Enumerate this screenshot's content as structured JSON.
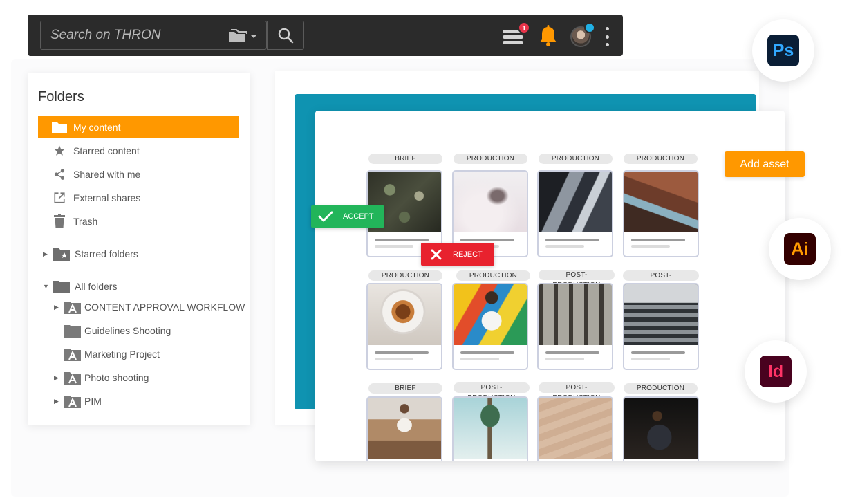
{
  "topbar": {
    "search_placeholder": "Search on THRON",
    "notifications_count": "1"
  },
  "folders": {
    "title": "Folders",
    "nav": [
      {
        "label": "My content",
        "icon": "folder-icon",
        "active": true
      },
      {
        "label": "Starred content",
        "icon": "star-icon"
      },
      {
        "label": "Shared with me",
        "icon": "share-icon"
      },
      {
        "label": "External shares",
        "icon": "external-link-icon"
      },
      {
        "label": "Trash",
        "icon": "trash-icon"
      }
    ],
    "starred_folders": "Starred folders",
    "all_folders": "All folders",
    "tree": [
      {
        "label": "CONTENT APPROVAL WORKFLOW",
        "icon": "shared-folder-icon",
        "expandable": true
      },
      {
        "label": "Guidelines Shooting",
        "icon": "folder-icon",
        "expandable": false
      },
      {
        "label": "Marketing Project",
        "icon": "shared-folder-icon",
        "expandable": false
      },
      {
        "label": "Photo shooting",
        "icon": "shared-folder-icon",
        "expandable": true
      },
      {
        "label": "PIM",
        "icon": "shared-folder-icon",
        "expandable": true
      }
    ]
  },
  "workflow": {
    "accept_label": "ACCEPT",
    "reject_label": "REJECT",
    "add_asset_label": "Add asset",
    "rows": [
      [
        "BRIEF",
        "PRODUCTION",
        "PRODUCTION",
        "PRODUCTION"
      ],
      [
        "PRODUCTION",
        "PRODUCTION",
        "POST-PRODUCTION",
        "POST-PRODUCTION"
      ],
      [
        "BRIEF",
        "POST-PRODUCTION",
        "POST-PRODUCTION",
        "PRODUCTION"
      ]
    ]
  },
  "apps": {
    "photoshop": "Ps",
    "illustrator": "Ai",
    "indesign": "Id"
  },
  "colors": {
    "accent": "#ff9800",
    "teal": "#0f93b1",
    "accept": "#22b55a",
    "reject": "#e8222e"
  }
}
